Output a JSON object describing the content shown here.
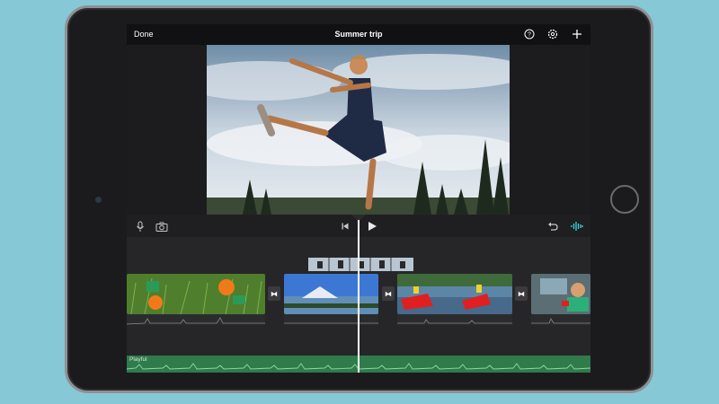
{
  "colors": {
    "background": "#86c8d6",
    "music_track": "#2f7b4a",
    "audio_waveform_active": "#3ad0e0",
    "bezel": "#1b1b1d"
  },
  "topbar": {
    "done_label": "Done",
    "title": "Summer trip",
    "icons": [
      "help-icon",
      "settings-icon",
      "add-icon"
    ]
  },
  "controls": {
    "icons": [
      "microphone-icon",
      "camera-icon",
      "skip-back-icon",
      "play-icon",
      "undo-icon",
      "audio-waveform-icon"
    ]
  },
  "timeline": {
    "music_track_label": "Playful",
    "clips": [
      {
        "name": "clip-grass-ball"
      },
      {
        "name": "clip-mountain-lake"
      },
      {
        "name": "clip-red-kayaks"
      },
      {
        "name": "clip-kid-in-car"
      }
    ],
    "transition_glyph": "⧓"
  }
}
